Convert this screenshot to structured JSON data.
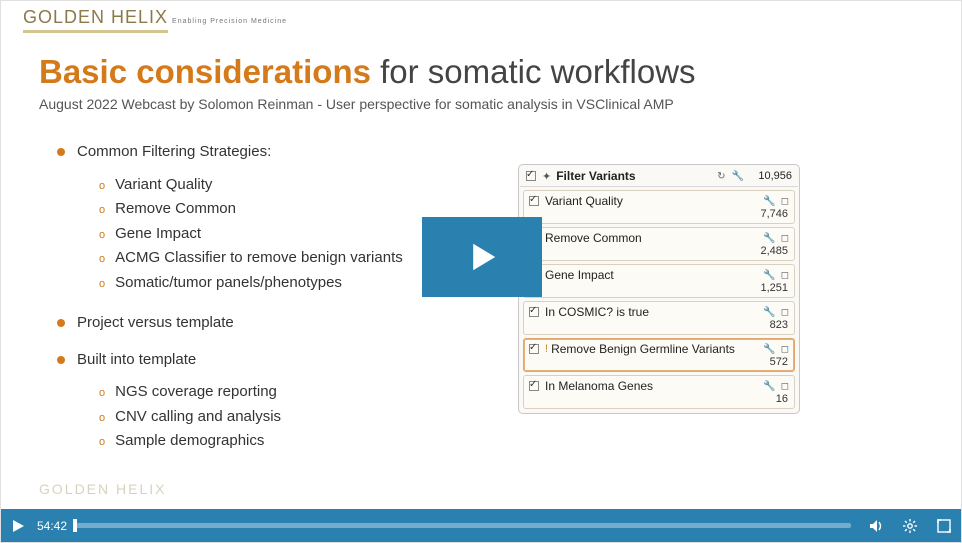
{
  "logo": {
    "main": "GOLDEN HELIX",
    "tagline": "Enabling Precision Medicine",
    "bottom": "GOLDEN HELIX"
  },
  "title": {
    "accent": "Basic considerations",
    "rest": " for somatic workflows"
  },
  "subtitle": "August 2022 Webcast by Solomon Reinman - User perspective for somatic analysis in VSClinical AMP",
  "bullets": {
    "b1": "Common Filtering Strategies:",
    "b1_items": [
      "Variant Quality",
      "Remove Common",
      "Gene Impact",
      "ACMG Classifier to remove benign variants",
      "Somatic/tumor panels/phenotypes"
    ],
    "b2": "Project versus template",
    "b3": "Built into template",
    "b3_items": [
      "NGS coverage reporting",
      "CNV calling and analysis",
      "Sample demographics"
    ]
  },
  "filter_panel": {
    "header": {
      "label": "Filter Variants",
      "count": "10,956"
    },
    "cards": [
      {
        "name": "Variant Quality",
        "count": "7,746",
        "warn": false
      },
      {
        "name": "Remove Common",
        "count": "2,485",
        "warn": false
      },
      {
        "name": "Gene Impact",
        "count": "1,251",
        "warn": false
      },
      {
        "name": "In COSMIC? is true",
        "count": "823",
        "warn": false
      },
      {
        "name": "Remove Benign Germline Variants",
        "count": "572",
        "warn": true,
        "active": true
      },
      {
        "name": "In Melanoma Genes",
        "count": "16",
        "warn": false
      }
    ]
  },
  "player": {
    "time": "54:42"
  }
}
